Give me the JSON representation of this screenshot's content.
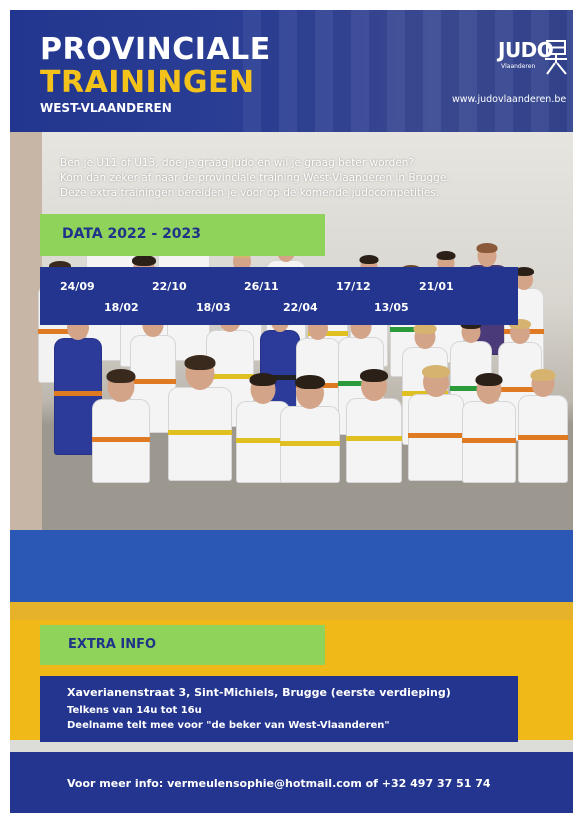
{
  "header": {
    "title_line1": "PROVINCIALE",
    "title_line2": "TRAININGEN",
    "subtitle": "WEST-VLAANDEREN",
    "logo_word": "JUDO",
    "logo_sub": "Vlaanderen",
    "website": "www.judovlaanderen.be"
  },
  "intro": {
    "line1": "Ben je U11 of U13, doe je graag judo en wil je graag beter worden?",
    "line2": "Kom dan zeker af naar de provinciale training West-Vlaanderen in Brugge.",
    "line3": "Deze extra trainingen bereiden je voor op de komende judocompetities."
  },
  "data_section": {
    "label": "DATA 2022 - 2023",
    "dates": [
      "24/09",
      "18/02",
      "22/10",
      "18/03",
      "26/11",
      "22/04",
      "17/12",
      "13/05",
      "21/01"
    ]
  },
  "extra_info": {
    "label": "EXTRA INFO",
    "line1": "Xaverianenstraat 3, Sint-Michiels, Brugge (eerste verdieping)",
    "line2": "Telkens van 14u tot 16u",
    "line3": "Deelname telt mee voor \"de beker van West-Vlaanderen\""
  },
  "footer": {
    "text": "Voor meer info: vermeulensophie@hotmail.com of +32 497 37 51 74"
  },
  "colors": {
    "navy": "#23358e",
    "title_yellow": "#f3c21b",
    "label_green": "#8fd35a",
    "band_yellow": "#f0b917",
    "mat_blue": "#2b57b5"
  },
  "icons": {
    "logo_mark": "judo-kanji-icon"
  }
}
